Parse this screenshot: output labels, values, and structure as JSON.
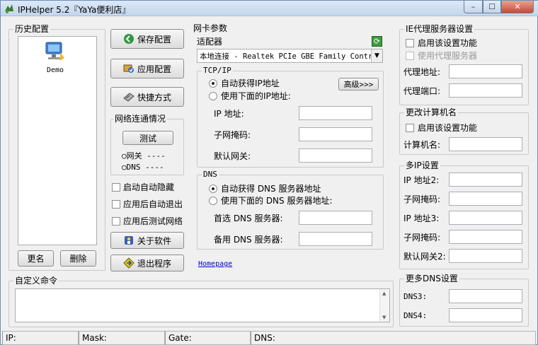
{
  "window": {
    "title": "IPHelper 5.2『YaYa便利店』",
    "controls": {
      "minimize": "–",
      "maximize": "☐",
      "close": "✕"
    }
  },
  "history": {
    "title": "历史配置",
    "items": [
      {
        "label": "Demo"
      }
    ],
    "rename_label": "更名",
    "delete_label": "删除"
  },
  "actions": {
    "save_label": "保存配置",
    "apply_label": "应用配置",
    "shortcut_label": "快捷方式",
    "about_label": "关于软件",
    "exit_label": "退出程序"
  },
  "network_status": {
    "title": "网络连通情况",
    "test_label": "测试",
    "gateway_label": "○网关 ----",
    "dns_label": "○DNS  ----"
  },
  "options": {
    "auto_hide": "启动自动隐藏",
    "exit_after_apply": "应用后自动退出",
    "test_after_apply": "应用后测试网络"
  },
  "nic": {
    "title": "网卡参数",
    "adapter_label": "适配器",
    "adapter_value": "本地连接 - Realtek PCIe GBE Family Contr",
    "tcpip_title": "TCP/IP",
    "auto_ip_label": "自动获得IP地址",
    "manual_ip_label": "使用下面的IP地址:",
    "advanced_label": "高级>>>",
    "ip_label": "IP 地址:",
    "mask_label": "子网掩码:",
    "gateway_label": "默认网关:",
    "dns_title": "DNS",
    "auto_dns_label": "自动获得 DNS 服务器地址",
    "manual_dns_label": "使用下面的 DNS 服务器地址:",
    "dns1_label": "首选 DNS 服务器:",
    "dns2_label": "备用 DNS 服务器:",
    "homepage_label": "Homepage"
  },
  "proxy": {
    "title": "IE代理服务器设置",
    "enable_label": "启用该设置功能",
    "use_proxy_label": "使用代理服务器",
    "address_label": "代理地址:",
    "port_label": "代理端口:"
  },
  "computer_name": {
    "title": "更改计算机名",
    "enable_label": "启用该设置功能",
    "name_label": "计算机名:"
  },
  "multi_ip": {
    "title": "多IP设置",
    "ip2_label": "IP 地址2:",
    "mask2_label": "子网掩码:",
    "ip3_label": "IP 地址3:",
    "mask3_label": "子网掩码:",
    "gateway2_label": "默认网关2:"
  },
  "more_dns": {
    "title": "更多DNS设置",
    "dns3_label": "DNS3:",
    "dns4_label": "DNS4:"
  },
  "custom_cmd": {
    "title": "自定义命令"
  },
  "statusbar": {
    "ip_label": "IP:",
    "mask_label": "Mask:",
    "gate_label": "Gate:",
    "dns_label": "DNS:"
  },
  "colors": {
    "link": "#0000cc",
    "accent_green": "#2e9a3c",
    "title_gradient_top": "#dbe8f6"
  }
}
